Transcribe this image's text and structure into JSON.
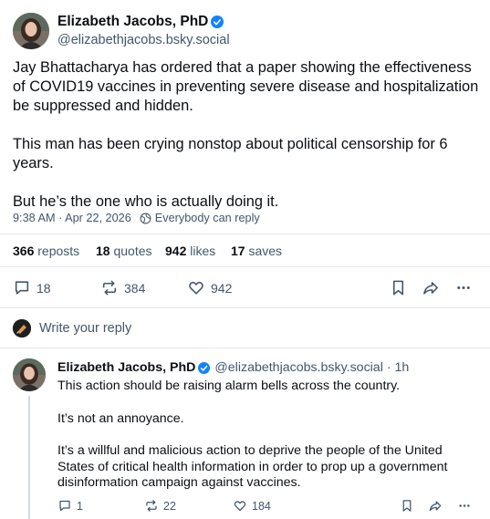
{
  "post": {
    "author_name": "Elizabeth Jacobs, PhD",
    "author_handle": "@elizabethjacobs.bsky.social",
    "paragraphs": [
      "Jay Bhattacharya has ordered that a paper showing the effectiveness of COVID19 vaccines in preventing severe disease and hospitalization be suppressed and hidden.",
      "This man has been crying nonstop about political censorship for 6 years.",
      "But he’s the one who is actually doing it."
    ],
    "timestamp": "9:38 AM · Apr 22, 2026",
    "reply_setting": "Everybody can reply",
    "stats": {
      "reposts_count": "366",
      "reposts_label": "reposts",
      "quotes_count": "18",
      "quotes_label": "quotes",
      "likes_count": "942",
      "likes_label": "likes",
      "saves_count": "17",
      "saves_label": "saves"
    },
    "actions": {
      "replies": "18",
      "reposts": "384",
      "likes": "942"
    }
  },
  "composer": {
    "placeholder": "Write your reply"
  },
  "reply": {
    "author_name": "Elizabeth Jacobs, PhD",
    "author_handle": "@elizabethjacobs.bsky.social",
    "age": "· 1h",
    "paragraphs": [
      "This action should be raising alarm bells across the country.",
      "It’s not an annoyance.",
      "It’s a willful and malicious action to deprive the people of the United States of critical health information in order to prop up a government disinformation campaign against vaccines."
    ],
    "actions": {
      "replies": "1",
      "reposts": "22",
      "likes": "184"
    }
  },
  "colors": {
    "verified_badge": "#1083fe",
    "muted_text": "#42576c",
    "divider": "#e3e8ee"
  },
  "icons": [
    "verified-badge-icon",
    "globe-icon",
    "reply-icon",
    "repost-icon",
    "like-icon",
    "bookmark-icon",
    "share-icon",
    "more-icon"
  ]
}
